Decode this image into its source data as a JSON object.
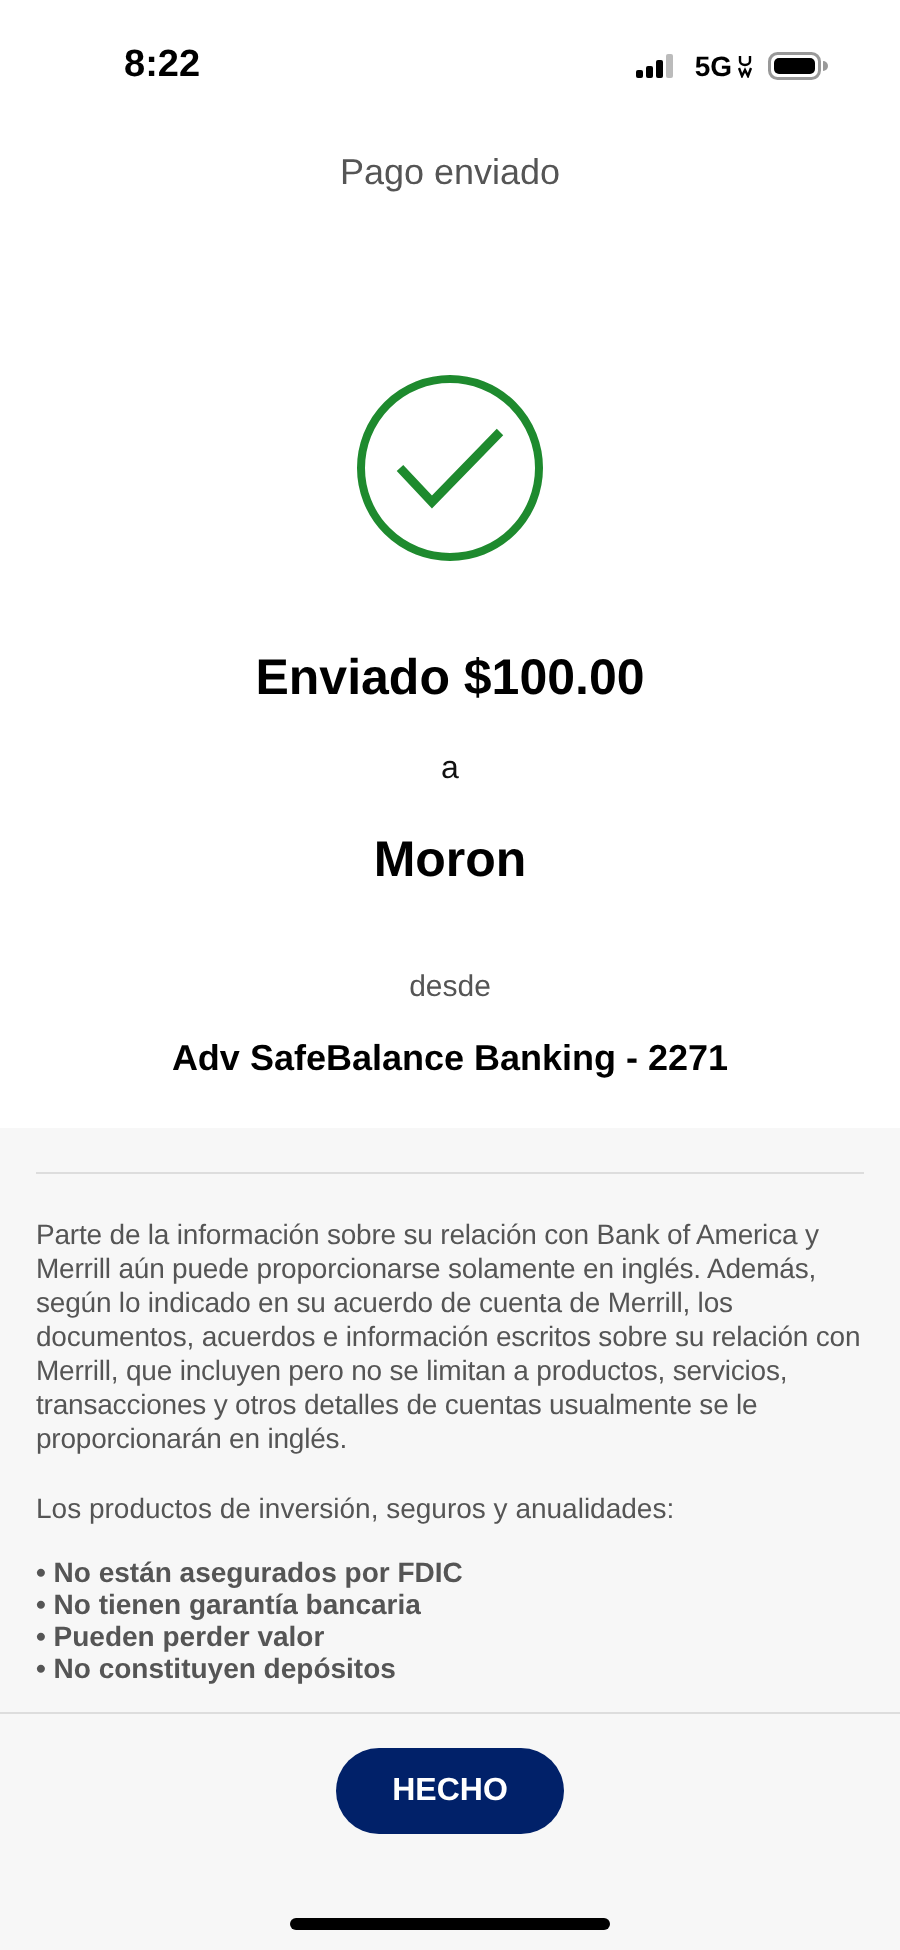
{
  "status_bar": {
    "time": "8:22",
    "network": "5G"
  },
  "header": {
    "title": "Pago enviado"
  },
  "confirmation": {
    "amount_text": "Enviado $100.00",
    "to_label": "a",
    "recipient": "Moron",
    "from_label": "desde",
    "account": "Adv SafeBalance Banking - 2271"
  },
  "disclosure": {
    "paragraph": "Parte de la información sobre su relación con Bank of America y Merrill aún puede proporcionarse solamente en inglés. Además, según lo indicado en su acuerdo de cuenta de Merrill, los documentos, acuerdos e información escritos sobre su relación con Merrill, que incluyen pero no se limitan a productos, servicios, transacciones y otros detalles de cuentas usualmente se le proporcionarán en inglés.",
    "intro": "Los productos de inversión, seguros y anualidades:",
    "bullets": [
      "• No están asegurados por FDIC",
      "• No tienen garantía bancaria",
      "• Pueden perder valor",
      "• No constituyen depósitos"
    ]
  },
  "footer": {
    "button": "HECHO"
  }
}
